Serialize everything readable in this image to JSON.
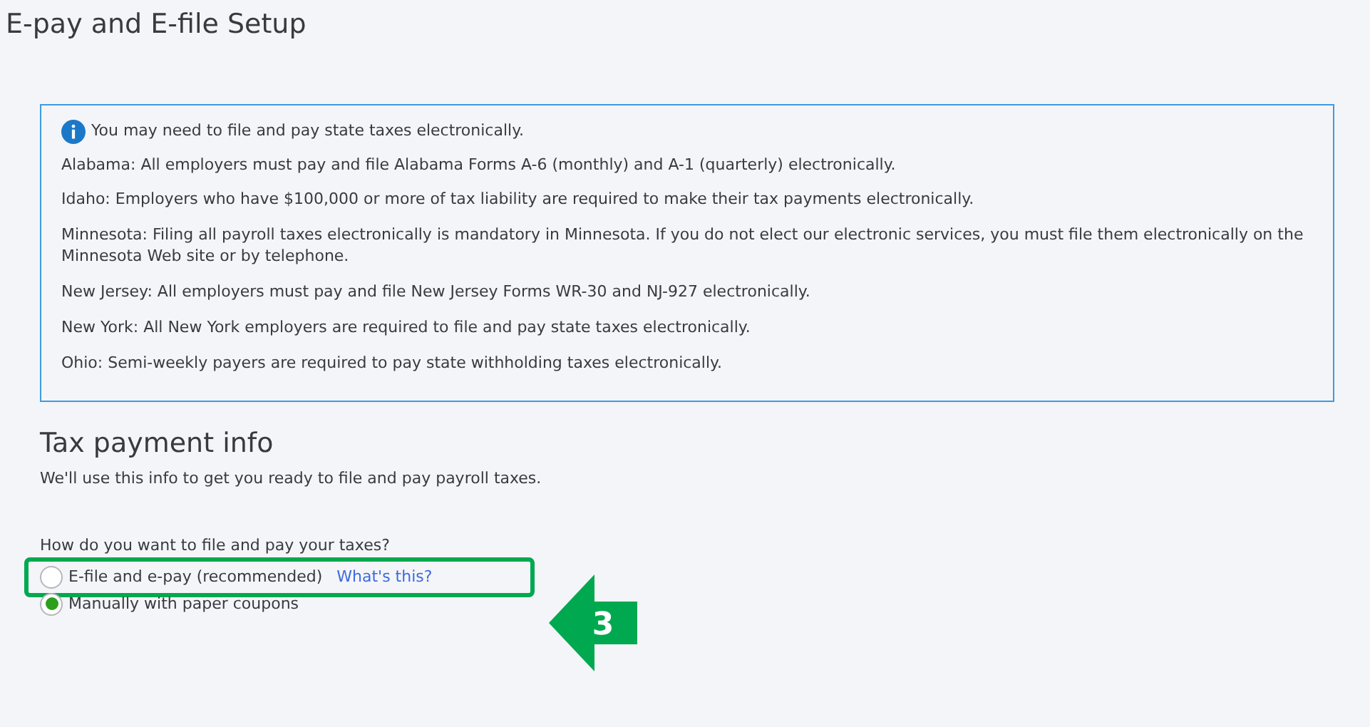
{
  "title": "E-pay and E-file Setup",
  "notice": {
    "heading": "You may need to file and pay state taxes electronically.",
    "lines": [
      "Alabama: All employers must pay and file Alabama Forms A-6 (monthly) and A-1 (quarterly) electronically.",
      "Idaho: Employers who have $100,000 or more of tax liability are required to make their tax payments electronically.",
      "Minnesota: Filing all payroll taxes electronically is mandatory in Minnesota. If you do not elect our electronic services, you must file them electronically on the Minnesota Web site or by telephone.",
      "New Jersey: All employers must pay and file New Jersey Forms WR-30 and NJ-927 electronically.",
      "New York: All New York employers are required to file and pay state taxes electronically.",
      "Ohio: Semi-weekly payers are required to pay state withholding taxes electronically."
    ]
  },
  "section": {
    "heading": "Tax payment info",
    "description": "We'll use this info to get you ready to file and pay payroll taxes.",
    "question": "How do you want to file and pay your taxes?",
    "options": [
      {
        "label": "E-file and e-pay (recommended)",
        "link": "What's this?",
        "selected": false
      },
      {
        "label": "Manually with paper coupons",
        "selected": true
      }
    ]
  },
  "callout": {
    "number": "3"
  }
}
